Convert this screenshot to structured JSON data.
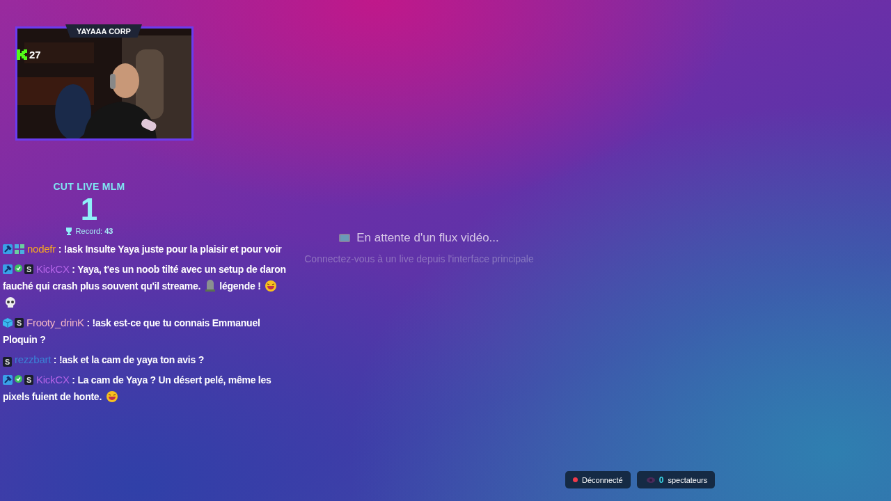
{
  "webcam": {
    "kind": "picture",
    "title": "YAYAAA CORP",
    "viewers": "27"
  },
  "counter": {
    "title": "CUT LIVE MLM",
    "value": "1",
    "record_label": "Record:",
    "record_value": "43"
  },
  "chat": [
    {
      "badges": [
        {
          "kind": "hammer"
        },
        {
          "kind": "grid"
        }
      ],
      "user": "nodefr",
      "color": "#f5a623",
      "separator": ":",
      "parts": [
        {
          "kind": "text",
          "text": "!ask Insulte Yaya juste pour la plaisir et pour voir"
        }
      ]
    },
    {
      "badges": [
        {
          "kind": "hammer"
        },
        {
          "kind": "verified"
        },
        {
          "kind": "sub",
          "text": "S"
        }
      ],
      "user": "KickCX",
      "color": "#b565e8",
      "separator": ":",
      "parts": [
        {
          "kind": "text",
          "text": "Yaya, t'es un noob tilté avec un setup de daron fauché qui crash plus souvent qu'il streame."
        },
        {
          "kind": "tombstone"
        },
        {
          "kind": "text",
          "text": "légende !"
        },
        {
          "kind": "laugh"
        },
        {
          "kind": "skull"
        }
      ]
    },
    {
      "badges": [
        {
          "kind": "cube"
        },
        {
          "kind": "sub",
          "text": "S"
        }
      ],
      "user": "Frooty_drinK",
      "color": "#f2b6c6",
      "separator": ":",
      "parts": [
        {
          "kind": "text",
          "text": "!ask est-ce que tu connais Emmanuel Ploquin ?"
        }
      ]
    },
    {
      "badges": [
        {
          "kind": "sub",
          "text": "S"
        }
      ],
      "user": "rezzbart",
      "color": "#3b82d6",
      "separator": ":",
      "parts": [
        {
          "kind": "text",
          "text": "!ask et la cam de yaya ton avis ?"
        }
      ]
    },
    {
      "badges": [
        {
          "kind": "hammer"
        },
        {
          "kind": "verified"
        },
        {
          "kind": "sub",
          "text": "S"
        }
      ],
      "user": "KickCX",
      "color": "#b565e8",
      "separator": ":",
      "parts": [
        {
          "kind": "text",
          "text": "La cam de Yaya ? Un désert pelé, même les pixels fuient de honte."
        },
        {
          "kind": "laugh"
        }
      ]
    }
  ],
  "waiting": {
    "title": "En attente d'un flux vidéo...",
    "subtitle": "Connectez-vous à un live depuis l'interface principale"
  },
  "status": {
    "connected": false,
    "label": "Déconnecté"
  },
  "audience": {
    "count": "0",
    "label": "spectateurs"
  }
}
